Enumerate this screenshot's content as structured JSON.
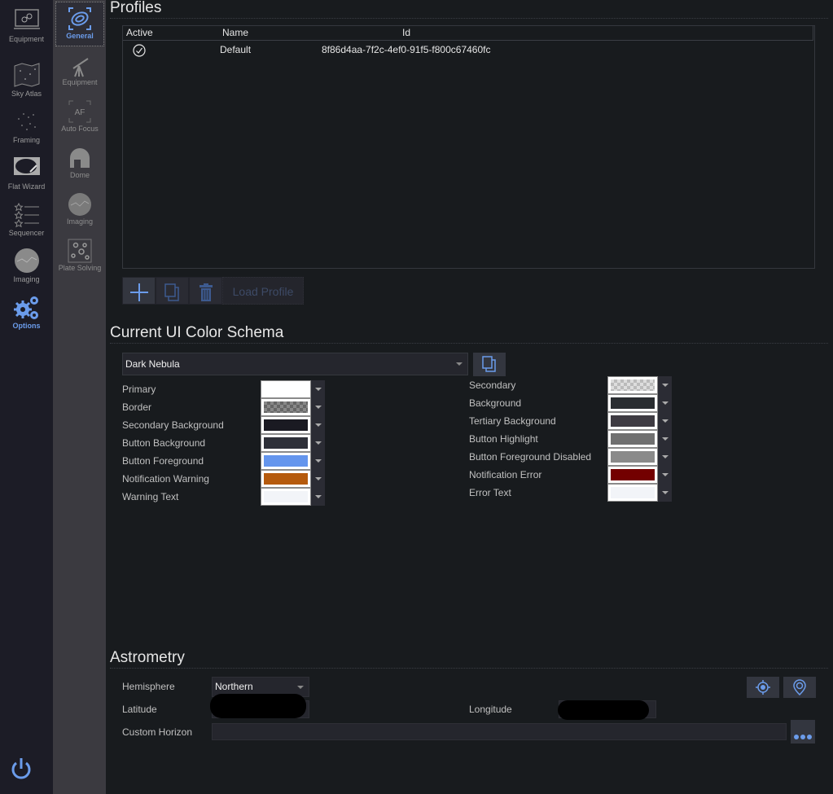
{
  "nav_main": {
    "items": [
      {
        "label": "Equipment",
        "icon": "equipment-icon"
      },
      {
        "label": "Sky Atlas",
        "icon": "sky-atlas-icon"
      },
      {
        "label": "Framing",
        "icon": "framing-icon"
      },
      {
        "label": "Flat Wizard",
        "icon": "flat-wizard-icon"
      },
      {
        "label": "Sequencer",
        "icon": "sequencer-icon"
      },
      {
        "label": "Imaging",
        "icon": "imaging-icon"
      },
      {
        "label": "Options",
        "icon": "options-gear-icon",
        "active": true
      }
    ],
    "power_icon": "power-icon"
  },
  "nav_sub": {
    "items": [
      {
        "label": "General",
        "icon": "general-galaxy-icon",
        "active": true
      },
      {
        "label": "Equipment",
        "icon": "telescope-icon"
      },
      {
        "label": "Auto Focus",
        "icon": "autofocus-icon",
        "glyph": "AF"
      },
      {
        "label": "Dome",
        "icon": "dome-icon"
      },
      {
        "label": "Imaging",
        "icon": "imaging-icon"
      },
      {
        "label": "Plate Solving",
        "icon": "plate-solving-icon"
      }
    ]
  },
  "profiles": {
    "title": "Profiles",
    "columns": [
      "Active",
      "Name",
      "Id"
    ],
    "rows": [
      {
        "active": true,
        "name": "Default",
        "id": "8f86d4aa-7f2c-4ef0-91f5-f800c67460fc"
      }
    ],
    "buttons": {
      "add_icon": "plus-icon",
      "copy_icon": "copy-icon",
      "delete_icon": "trash-icon",
      "load_label": "Load Profile"
    }
  },
  "color_schema": {
    "title": "Current UI Color Schema",
    "selected": "Dark Nebula",
    "left": [
      {
        "label": "Primary",
        "color": "#FFFFFF"
      },
      {
        "label": "Border",
        "color": "checker-gray"
      },
      {
        "label": "Secondary Background",
        "color": "#1A1A22"
      },
      {
        "label": "Button Background",
        "color": "#2E3039"
      },
      {
        "label": "Button Foreground",
        "color": "#6495ED"
      },
      {
        "label": "Notification Warning",
        "color": "#B55A0D"
      },
      {
        "label": "Warning Text",
        "color": "#F2F4F8"
      }
    ],
    "right": [
      {
        "label": "Secondary",
        "color": "checker-light"
      },
      {
        "label": "Background",
        "color": "#2A2D31"
      },
      {
        "label": "Tertiary Background",
        "color": "#3E3B42"
      },
      {
        "label": "Button Highlight",
        "color": "#707070"
      },
      {
        "label": "Button Foreground Disabled",
        "color": "#8A8A8A"
      },
      {
        "label": "Notification Error",
        "color": "#730000"
      },
      {
        "label": "Error Text",
        "color": "#F2F4F8"
      }
    ]
  },
  "astrometry": {
    "title": "Astrometry",
    "hemisphere_label": "Hemisphere",
    "hemisphere_value": "Northern",
    "latitude_label": "Latitude",
    "longitude_label": "Longitude",
    "custom_horizon_label": "Custom Horizon",
    "custom_horizon_value": "",
    "browse_icon": "ellipsis-icon",
    "gps_icon": "crosshair-location-icon",
    "map_icon": "map-pin-icon"
  }
}
